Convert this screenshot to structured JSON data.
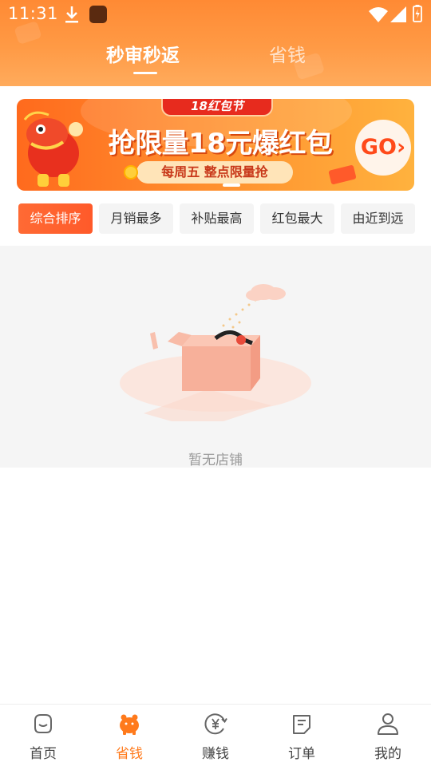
{
  "status_bar": {
    "time": "11:31"
  },
  "header": {
    "tabs": [
      {
        "label": "秒审秒返",
        "active": true
      },
      {
        "label": "省钱",
        "active": false
      }
    ]
  },
  "banner": {
    "tag": "18红包节",
    "title": "抢限量18元爆红包",
    "subtitle": "每周五 整点限量抢",
    "cta": "GO"
  },
  "filters": [
    {
      "label": "综合排序",
      "active": true
    },
    {
      "label": "月销最多",
      "active": false
    },
    {
      "label": "补贴最高",
      "active": false
    },
    {
      "label": "红包最大",
      "active": false
    },
    {
      "label": "由近到远",
      "active": false
    }
  ],
  "empty_state": {
    "message": "暂无店铺"
  },
  "bottom_nav": [
    {
      "label": "首页",
      "icon": "home-icon",
      "active": false
    },
    {
      "label": "省钱",
      "icon": "piggy-bank-icon",
      "active": true
    },
    {
      "label": "赚钱",
      "icon": "yuan-coin-icon",
      "active": false
    },
    {
      "label": "订单",
      "icon": "order-list-icon",
      "active": false
    },
    {
      "label": "我的",
      "icon": "user-icon",
      "active": false
    }
  ],
  "colors": {
    "brand_orange": "#ff8a34",
    "active_chip": "#ff5a2a",
    "active_nav": "#ff7a1c",
    "empty_bg": "#f5f5f5"
  }
}
